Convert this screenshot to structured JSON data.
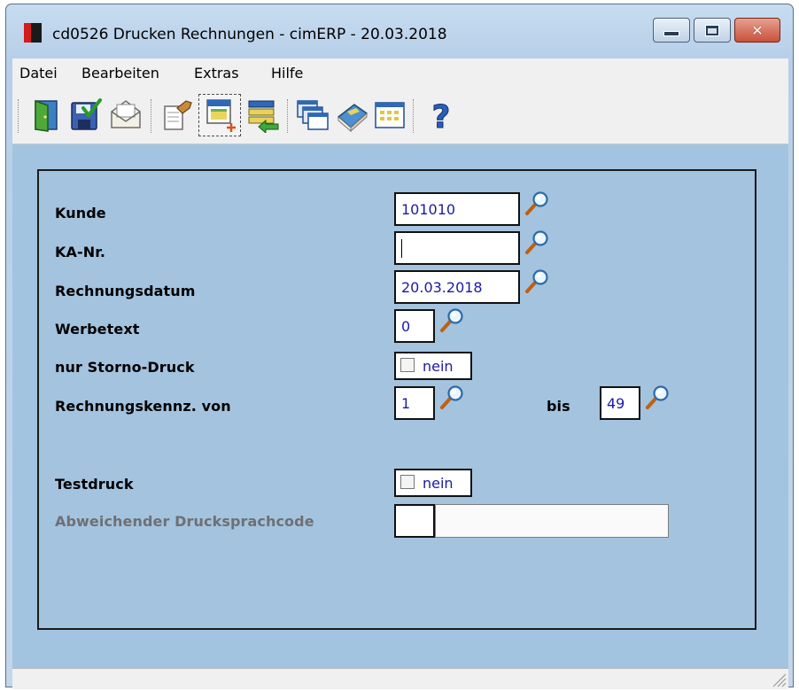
{
  "window": {
    "title": "cd0526 Drucken Rechnungen - cimERP - 20.03.2018"
  },
  "menu": {
    "items": [
      "Datei",
      "Bearbeiten",
      "Extras",
      "Hilfe"
    ]
  },
  "toolbar": {
    "buttons": [
      {
        "icon": "exit-door-icon"
      },
      {
        "icon": "save-check-icon"
      },
      {
        "icon": "envelope-icon"
      },
      {
        "icon": "hand-document-icon"
      },
      {
        "icon": "new-calendar-icon"
      },
      {
        "icon": "list-arrow-icon"
      },
      {
        "icon": "windows-icon"
      },
      {
        "icon": "book-icon"
      },
      {
        "icon": "grid-icon"
      },
      {
        "icon": "help-icon"
      }
    ]
  },
  "form": {
    "kunde": {
      "label": "Kunde",
      "value": "101010"
    },
    "ka_nr": {
      "label": "KA-Nr.",
      "value": ""
    },
    "rechnungsdatum": {
      "label": "Rechnungsdatum",
      "value": "20.03.2018"
    },
    "werbetext": {
      "label": "Werbetext",
      "value": "0"
    },
    "storno": {
      "label": "nur Storno-Druck",
      "value": "nein",
      "checked": false
    },
    "kennz": {
      "label": "Rechnungskennz. von",
      "from": "1",
      "to_label": "bis",
      "to": "49"
    },
    "testdruck": {
      "label": "Testdruck",
      "value": "nein",
      "checked": false
    },
    "sprachcode": {
      "label": "Abweichender Drucksprachcode",
      "code": "",
      "text": ""
    }
  },
  "status": {
    "text": ""
  },
  "colors": {
    "window_bg": "#a3c4e0",
    "field_text": "#1a1aa8",
    "disabled_label": "#6e7074"
  }
}
